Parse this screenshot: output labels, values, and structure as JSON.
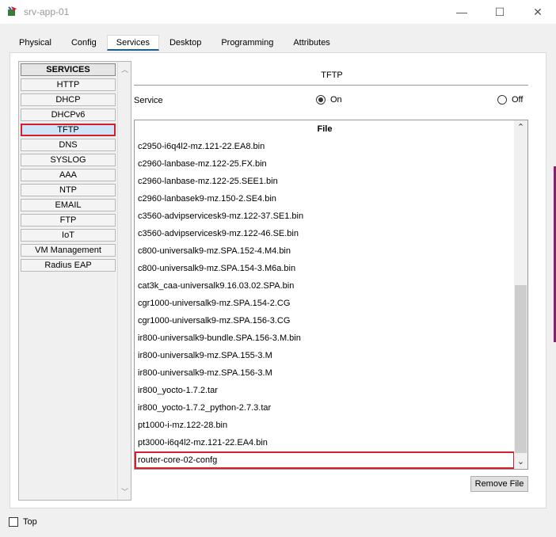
{
  "window": {
    "title": "srv-app-01",
    "icon": "router-icon",
    "controls": {
      "minimize": "—",
      "maximize": "☐",
      "close": "✕"
    }
  },
  "tabs": [
    {
      "label": "Physical",
      "active": false
    },
    {
      "label": "Config",
      "active": false
    },
    {
      "label": "Services",
      "active": true
    },
    {
      "label": "Desktop",
      "active": false
    },
    {
      "label": "Programming",
      "active": false
    },
    {
      "label": "Attributes",
      "active": false
    }
  ],
  "services": {
    "header": "SERVICES",
    "items": [
      "HTTP",
      "DHCP",
      "DHCPv6",
      "TFTP",
      "DNS",
      "SYSLOG",
      "AAA",
      "NTP",
      "EMAIL",
      "FTP",
      "IoT",
      "VM Management",
      "Radius EAP"
    ],
    "selected": "TFTP"
  },
  "tftp": {
    "title": "TFTP",
    "service_label": "Service",
    "on_label": "On",
    "off_label": "Off",
    "state": "On",
    "file_header": "File",
    "files": [
      "c2950-i6q4l2-mz.121-22.EA8.bin",
      "c2960-lanbase-mz.122-25.FX.bin",
      "c2960-lanbase-mz.122-25.SEE1.bin",
      "c2960-lanbasek9-mz.150-2.SE4.bin",
      "c3560-advipservicesk9-mz.122-37.SE1.bin",
      "c3560-advipservicesk9-mz.122-46.SE.bin",
      "c800-universalk9-mz.SPA.152-4.M4.bin",
      "c800-universalk9-mz.SPA.154-3.M6a.bin",
      "cat3k_caa-universalk9.16.03.02.SPA.bin",
      "cgr1000-universalk9-mz.SPA.154-2.CG",
      "cgr1000-universalk9-mz.SPA.156-3.CG",
      "ir800-universalk9-bundle.SPA.156-3.M.bin",
      "ir800-universalk9-mz.SPA.155-3.M",
      "ir800-universalk9-mz.SPA.156-3.M",
      "ir800_yocto-1.7.2.tar",
      "ir800_yocto-1.7.2_python-2.7.3.tar",
      "pt1000-i-mz.122-28.bin",
      "pt3000-i6q4l2-mz.121-22.EA4.bin",
      "router-core-02-confg"
    ],
    "selected_file": "router-core-02-confg",
    "remove_button": "Remove File"
  },
  "footer": {
    "top_label": "Top",
    "top_checked": false
  },
  "colors": {
    "highlight_border": "#d4202c",
    "selected_service_bg": "#cfe4f7",
    "active_tab_underline": "#1b5e8c"
  }
}
